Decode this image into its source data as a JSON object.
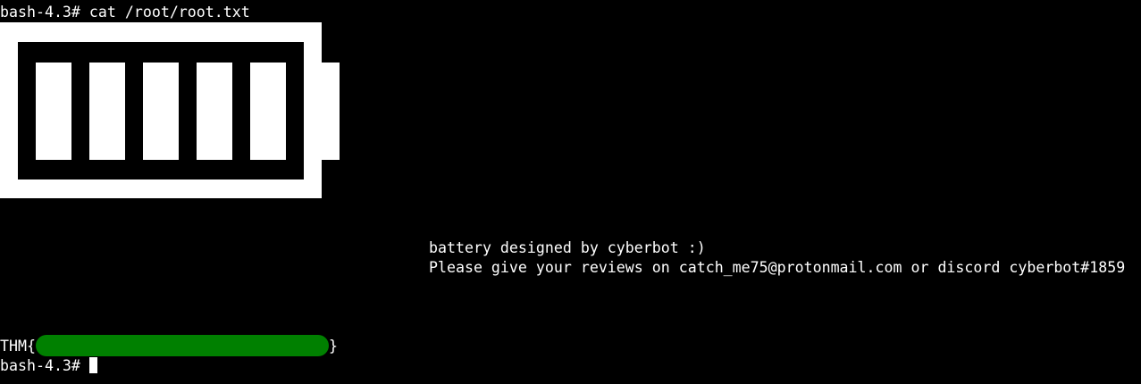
{
  "terminal": {
    "background": "#000000",
    "foreground": "#ffffff",
    "command_line": "bash-4.3# cat /root/root.txt",
    "banner": {
      "line1": "battery designed by cyberbot :)",
      "line2": "Please give your reviews on catch_me75@protonmail.com or discord cyberbot#1859"
    },
    "flag": {
      "prefix": "THM{",
      "suffix": "}",
      "redaction_color": "#008000"
    },
    "prompt": "bash-4.3# ",
    "battery_art": {
      "cells_filled": 5,
      "cells_total": 5
    }
  }
}
